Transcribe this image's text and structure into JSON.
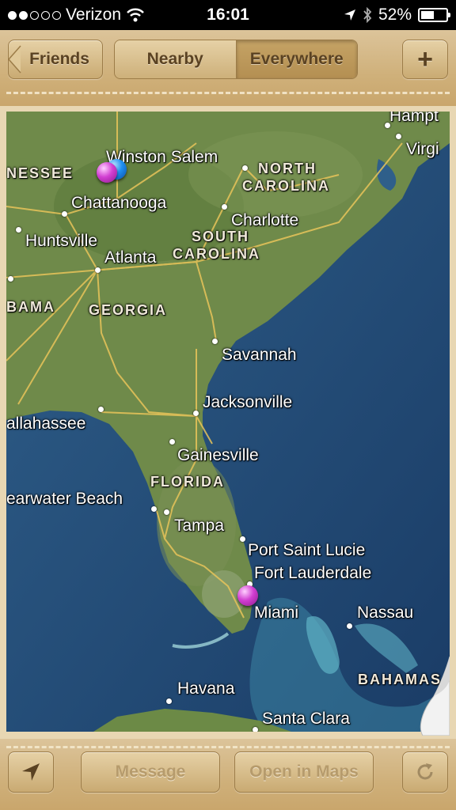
{
  "status_bar": {
    "carrier": "Verizon",
    "time": "16:01",
    "battery_percent": "52%",
    "battery_level": 0.52
  },
  "nav": {
    "back_label": "Friends",
    "segments": [
      "Nearby",
      "Everywhere"
    ],
    "selected_segment": "Everywhere",
    "add_label": "+"
  },
  "map": {
    "cities": [
      {
        "label": "Hampt"
      },
      {
        "label": "Virgi"
      },
      {
        "label": "Winston Salem"
      },
      {
        "label": "Chattanooga"
      },
      {
        "label": "Charlotte"
      },
      {
        "label": "Huntsville"
      },
      {
        "label": "Atlanta"
      },
      {
        "label": "Savannah"
      },
      {
        "label": "Jacksonville"
      },
      {
        "label": "allahassee"
      },
      {
        "label": "Gainesville"
      },
      {
        "label": "earwater Beach"
      },
      {
        "label": "Tampa"
      },
      {
        "label": "Port Saint Lucie"
      },
      {
        "label": "Fort Lauderdale"
      },
      {
        "label": "Miami"
      },
      {
        "label": "Nassau"
      },
      {
        "label": "Havana"
      },
      {
        "label": "Santa Clara"
      }
    ],
    "regions": [
      {
        "label": "NESSEE"
      },
      {
        "label": "NORTH"
      },
      {
        "label": "CAROLINA"
      },
      {
        "label": "SOUTH"
      },
      {
        "label": "CAROLINA"
      },
      {
        "label": "BAMA"
      },
      {
        "label": "GEORGIA"
      },
      {
        "label": "FLORIDA"
      },
      {
        "label": "BAHAMAS"
      }
    ]
  },
  "toolbar": {
    "message_label": "Message",
    "open_maps_label": "Open in Maps"
  },
  "colors": {
    "leather": "#cfb07a",
    "ocean": "#1f4a78",
    "land": "#6f8a4a",
    "pin_purple": "#d23fd2",
    "pin_blue": "#1f8ff0"
  }
}
